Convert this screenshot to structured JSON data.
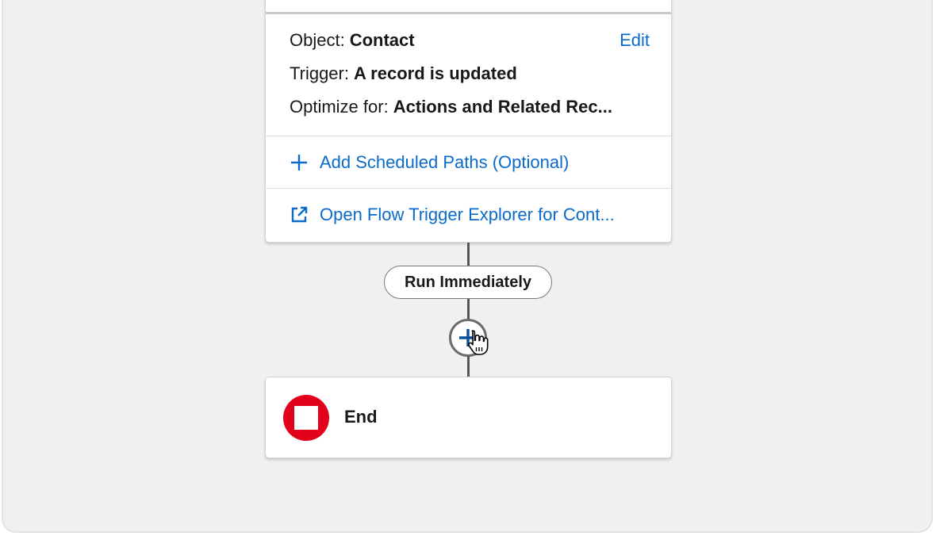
{
  "start": {
    "object_label": "Object:",
    "object_value": "Contact",
    "edit_label": "Edit",
    "trigger_label": "Trigger:",
    "trigger_value": "A record is updated",
    "optimize_label": "Optimize for:",
    "optimize_value": "Actions and Related Rec...",
    "add_paths_label": "Add Scheduled Paths (Optional)",
    "explorer_label": "Open Flow Trigger Explorer for Cont..."
  },
  "path": {
    "label": "Run Immediately"
  },
  "end": {
    "label": "End"
  },
  "colors": {
    "link": "#0b6bcb",
    "end_icon": "#e3001a",
    "canvas": "#f0f0f1"
  },
  "icons": {
    "add": "plus-icon",
    "explorer": "external-link-icon",
    "node": "plus-icon",
    "cursor": "hand-pointer-icon",
    "end": "stop-icon"
  }
}
